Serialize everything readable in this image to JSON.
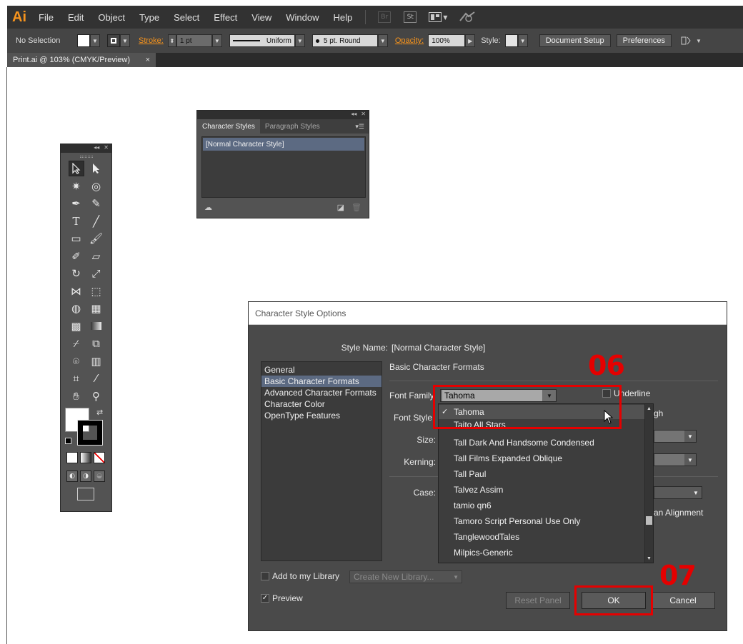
{
  "app": {
    "logo": "Ai",
    "menu": [
      "File",
      "Edit",
      "Object",
      "Type",
      "Select",
      "Effect",
      "View",
      "Window",
      "Help"
    ],
    "menu_icons": [
      "bridge-icon",
      "stock-icon",
      "arrange-documents-icon",
      "gpu-performance-icon"
    ],
    "menu_icon_labels": {
      "bridge": "Br",
      "stock": "St"
    }
  },
  "control_bar": {
    "selection_label": "No Selection",
    "stroke_label": "Stroke:",
    "stroke_weight": "1 pt",
    "profile": "Uniform",
    "brush": "5 pt. Round",
    "opacity_label": "Opacity:",
    "opacity": "100%",
    "style_label": "Style:",
    "document_setup": "Document Setup",
    "preferences": "Preferences"
  },
  "document_tab": {
    "title": "Print.ai @ 103% (CMYK/Preview)",
    "close": "×"
  },
  "character_styles_panel": {
    "tabs": [
      "Character Styles",
      "Paragraph Styles"
    ],
    "styles": [
      "[Normal Character Style]"
    ]
  },
  "dialog": {
    "title": "Character Style Options",
    "style_name_label": "Style Name:",
    "style_name": "[Normal Character Style]",
    "nav": [
      "General",
      "Basic Character Formats",
      "Advanced Character Formats",
      "Character Color",
      "OpenType Features"
    ],
    "selected_nav": "Basic Character Formats",
    "section_title": "Basic Character Formats",
    "font_family_label": "Font Family",
    "font_family_value": "Tahoma",
    "font_style_label": "Font Style",
    "size_label": "Size:",
    "kerning_label": "Kerning:",
    "case_label": "Case:",
    "underline_label": "Underline",
    "strikethrough_partial": "gh",
    "alignment_partial": "an Alignment",
    "add_to_library_label": "Add to my Library",
    "library_placeholder": "Create New Library...",
    "preview_label": "Preview",
    "preview_checked": true,
    "reset_panel": "Reset Panel",
    "ok": "OK",
    "cancel": "Cancel"
  },
  "font_dropdown": {
    "selected": "Tahoma",
    "items": [
      "Tahoma",
      "Taito All Stars",
      "Tall Dark And Handsome Condensed",
      "Tall Films Expanded Oblique",
      "Tall Paul",
      "Talvez Assim",
      "tamio qn6",
      "Tamoro Script Personal Use Only",
      "TanglewoodTales",
      "Milpics-Generic"
    ],
    "check_mark": "✓"
  },
  "annotations": {
    "step_06": "06",
    "step_07": "07",
    "color": "#e50000"
  },
  "colors": {
    "menubar": "#323232",
    "controlbar": "#454545",
    "panel": "#535353",
    "selection": "#5c6a82",
    "accent_orange": "#f7941d"
  }
}
